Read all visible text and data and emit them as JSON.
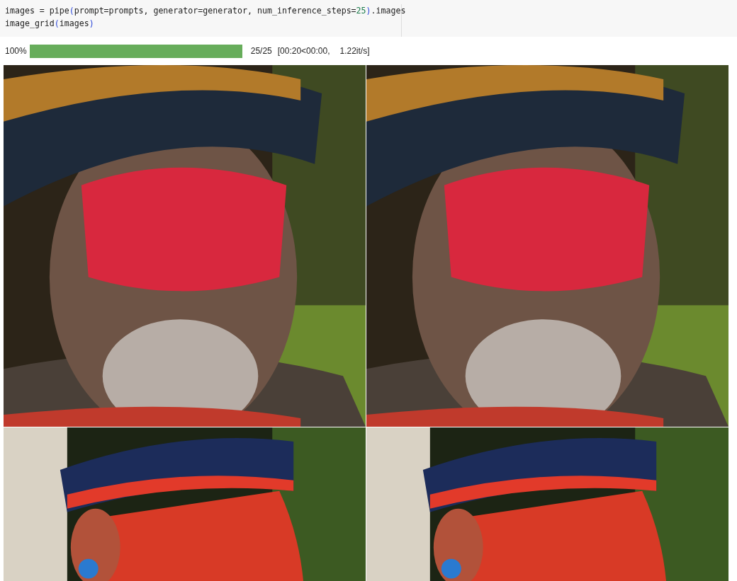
{
  "code_cell": {
    "lines": [
      [
        {
          "text": "images = pipe",
          "kind": "plain"
        },
        {
          "text": "(",
          "kind": "paren"
        },
        {
          "text": "prompt=prompts, generator=generator, num_inference_steps=",
          "kind": "plain"
        },
        {
          "text": "25",
          "kind": "number"
        },
        {
          "text": ")",
          "kind": "paren"
        },
        {
          "text": ".images",
          "kind": "plain"
        }
      ],
      [
        {
          "text": "image_grid",
          "kind": "plain"
        },
        {
          "text": "(",
          "kind": "paren"
        },
        {
          "text": "images",
          "kind": "plain"
        },
        {
          "text": ")",
          "kind": "paren"
        }
      ]
    ]
  },
  "progress": {
    "percent": "100%",
    "level": 1,
    "count": "25/25",
    "timing": "[00:20<00:00,",
    "rate": "1.22it/s]"
  },
  "images": [
    {
      "kind": "front"
    },
    {
      "kind": "front"
    },
    {
      "kind": "side"
    },
    {
      "kind": "side"
    }
  ]
}
